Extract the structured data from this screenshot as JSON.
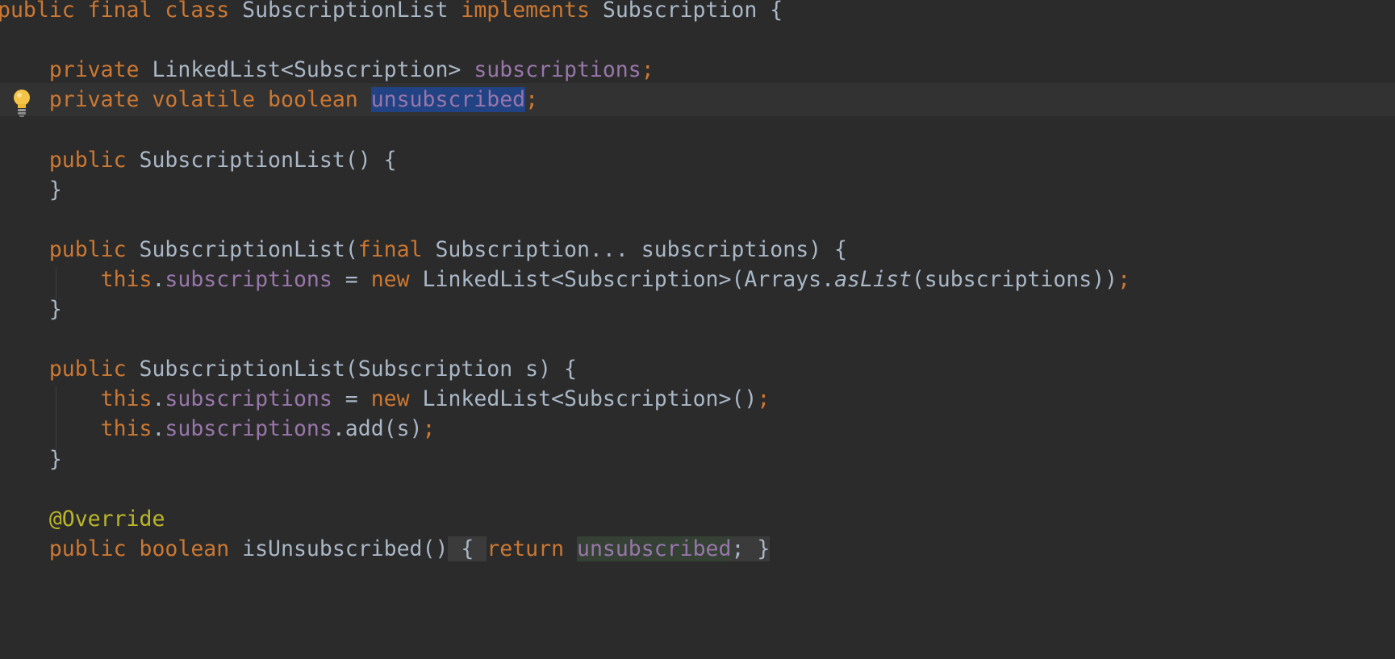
{
  "editor": {
    "lines": [
      [
        {
          "t": "public final class ",
          "c": "kw"
        },
        {
          "t": "SubscriptionList ",
          "c": ""
        },
        {
          "t": "implements ",
          "c": "kw"
        },
        {
          "t": "Subscription {",
          "c": ""
        }
      ],
      [],
      [
        {
          "t": "    private ",
          "c": "kw"
        },
        {
          "t": "LinkedList<Subscription> ",
          "c": ""
        },
        {
          "t": "subscriptions",
          "c": "field"
        },
        {
          "t": ";",
          "c": "kw"
        }
      ],
      [
        {
          "t": "    private volatile boolean ",
          "c": "kw"
        },
        {
          "t": "unsubscribed",
          "c": "field sel"
        },
        {
          "t": ";",
          "c": "kw"
        }
      ],
      [],
      [
        {
          "t": "    public ",
          "c": "kw"
        },
        {
          "t": "SubscriptionList() {",
          "c": ""
        }
      ],
      [
        {
          "t": "    }",
          "c": ""
        }
      ],
      [],
      [
        {
          "t": "    public ",
          "c": "kw"
        },
        {
          "t": "SubscriptionList(",
          "c": ""
        },
        {
          "t": "final ",
          "c": "kw"
        },
        {
          "t": "Subscription... subscriptions) {",
          "c": ""
        }
      ],
      [
        {
          "t": "        this",
          "c": "kw"
        },
        {
          "t": ".",
          "c": ""
        },
        {
          "t": "subscriptions",
          "c": "field"
        },
        {
          "t": " = ",
          "c": ""
        },
        {
          "t": "new ",
          "c": "kw"
        },
        {
          "t": "LinkedList<Subscription>(Arrays.",
          "c": ""
        },
        {
          "t": "asList",
          "c": "italic"
        },
        {
          "t": "(subscriptions))",
          "c": ""
        },
        {
          "t": ";",
          "c": "kw"
        }
      ],
      [
        {
          "t": "    }",
          "c": ""
        }
      ],
      [],
      [
        {
          "t": "    public ",
          "c": "kw"
        },
        {
          "t": "SubscriptionList(Subscription s) {",
          "c": ""
        }
      ],
      [
        {
          "t": "        this",
          "c": "kw"
        },
        {
          "t": ".",
          "c": ""
        },
        {
          "t": "subscriptions",
          "c": "field"
        },
        {
          "t": " = ",
          "c": ""
        },
        {
          "t": "new ",
          "c": "kw"
        },
        {
          "t": "LinkedList<Subscription>()",
          "c": ""
        },
        {
          "t": ";",
          "c": "kw"
        }
      ],
      [
        {
          "t": "        this",
          "c": "kw"
        },
        {
          "t": ".",
          "c": ""
        },
        {
          "t": "subscriptions",
          "c": "field"
        },
        {
          "t": ".add(s)",
          "c": ""
        },
        {
          "t": ";",
          "c": "kw"
        }
      ],
      [
        {
          "t": "    }",
          "c": ""
        }
      ],
      [],
      [
        {
          "t": "    @Override",
          "c": "ann"
        }
      ],
      [
        {
          "t": "    public boolean ",
          "c": "kw"
        },
        {
          "t": "isUnsubscribed()",
          "c": ""
        },
        {
          "t": " { ",
          "c": "fold"
        },
        {
          "t": "return ",
          "c": "kw"
        },
        {
          "t": "unsubscribed",
          "c": "field usage"
        },
        {
          "t": "; }",
          "c": "fold"
        }
      ]
    ],
    "caret_line": 3,
    "intention_icon": "lightbulb-icon"
  }
}
